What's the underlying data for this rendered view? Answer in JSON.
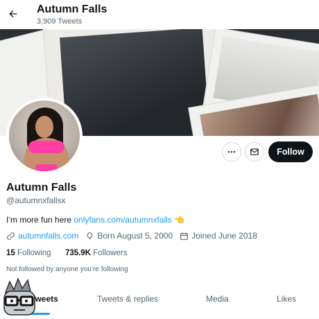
{
  "header": {
    "back_icon": "arrow-left-icon",
    "name": "Autumn Falls",
    "tweet_count": "3,909 Tweets"
  },
  "profile": {
    "name": "Autumn Falls",
    "handle": "@autumnxfallsx",
    "bio_text": "I’m more fun here ",
    "bio_link": "onlyfans.com/autumnxfalls",
    "bio_emoji": "👈",
    "website": "autumnfalls.com",
    "birthday": "Born August 5, 2000",
    "joined": "Joined June 2018",
    "following_count": "15",
    "following_label": "Following",
    "followers_count": "735.9K",
    "followers_label": "Followers",
    "not_followed_note": "Not followed by anyone you’re following"
  },
  "actions": {
    "more_icon": "more-icon",
    "message_icon": "mail-icon",
    "follow_label": "Follow"
  },
  "tabs": [
    {
      "label": "Tweets"
    },
    {
      "label": "Tweets & replies"
    },
    {
      "label": "Media"
    },
    {
      "label": "Likes"
    }
  ],
  "colors": {
    "accent": "#1d9bf0",
    "text": "#0f1419",
    "secondary": "#536471",
    "follow_bg": "#0f1419"
  }
}
